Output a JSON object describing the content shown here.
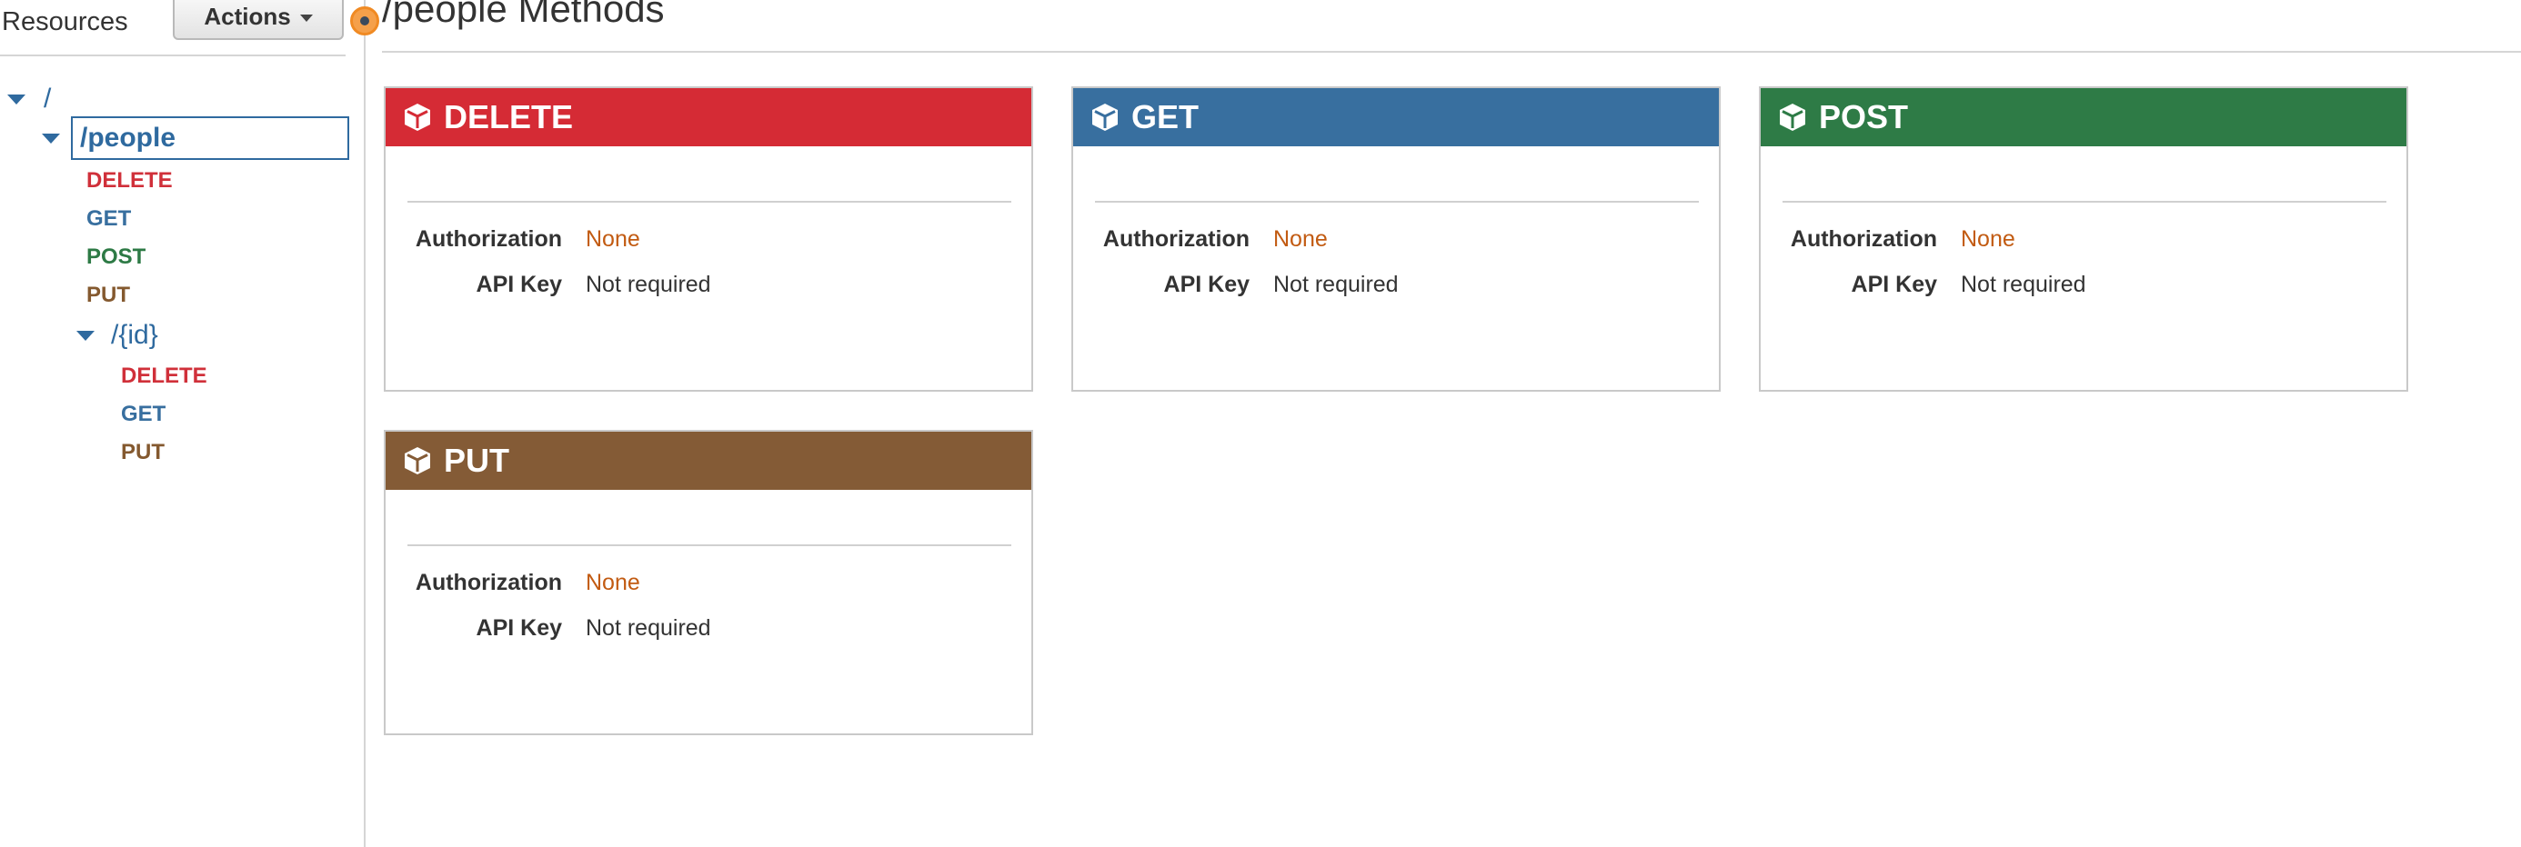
{
  "left_panel": {
    "title": "Resources",
    "actions_label": "Actions",
    "tree": {
      "root": "/",
      "people": "/people",
      "people_methods": [
        "DELETE",
        "GET",
        "POST",
        "PUT"
      ],
      "id": "/{id}",
      "id_methods": [
        "DELETE",
        "GET",
        "PUT"
      ]
    }
  },
  "main": {
    "title": "/people Methods",
    "cards": [
      {
        "method": "DELETE",
        "auth_label": "Authorization",
        "auth_value": "None",
        "apikey_label": "API Key",
        "apikey_value": "Not required"
      },
      {
        "method": "GET",
        "auth_label": "Authorization",
        "auth_value": "None",
        "apikey_label": "API Key",
        "apikey_value": "Not required"
      },
      {
        "method": "POST",
        "auth_label": "Authorization",
        "auth_value": "None",
        "apikey_label": "API Key",
        "apikey_value": "Not required"
      },
      {
        "method": "PUT",
        "auth_label": "Authorization",
        "auth_value": "None",
        "apikey_label": "API Key",
        "apikey_value": "Not required"
      }
    ]
  },
  "colors": {
    "delete": "#d52b35",
    "get": "#386f9f",
    "post": "#2e7b46",
    "put": "#845b36",
    "link": "#c25b12",
    "tree_link": "#2f6a9f"
  },
  "icons": {
    "card_header": "cube-icon",
    "tree_toggle": "triangle-down-icon",
    "actions": "caret-down-icon"
  }
}
